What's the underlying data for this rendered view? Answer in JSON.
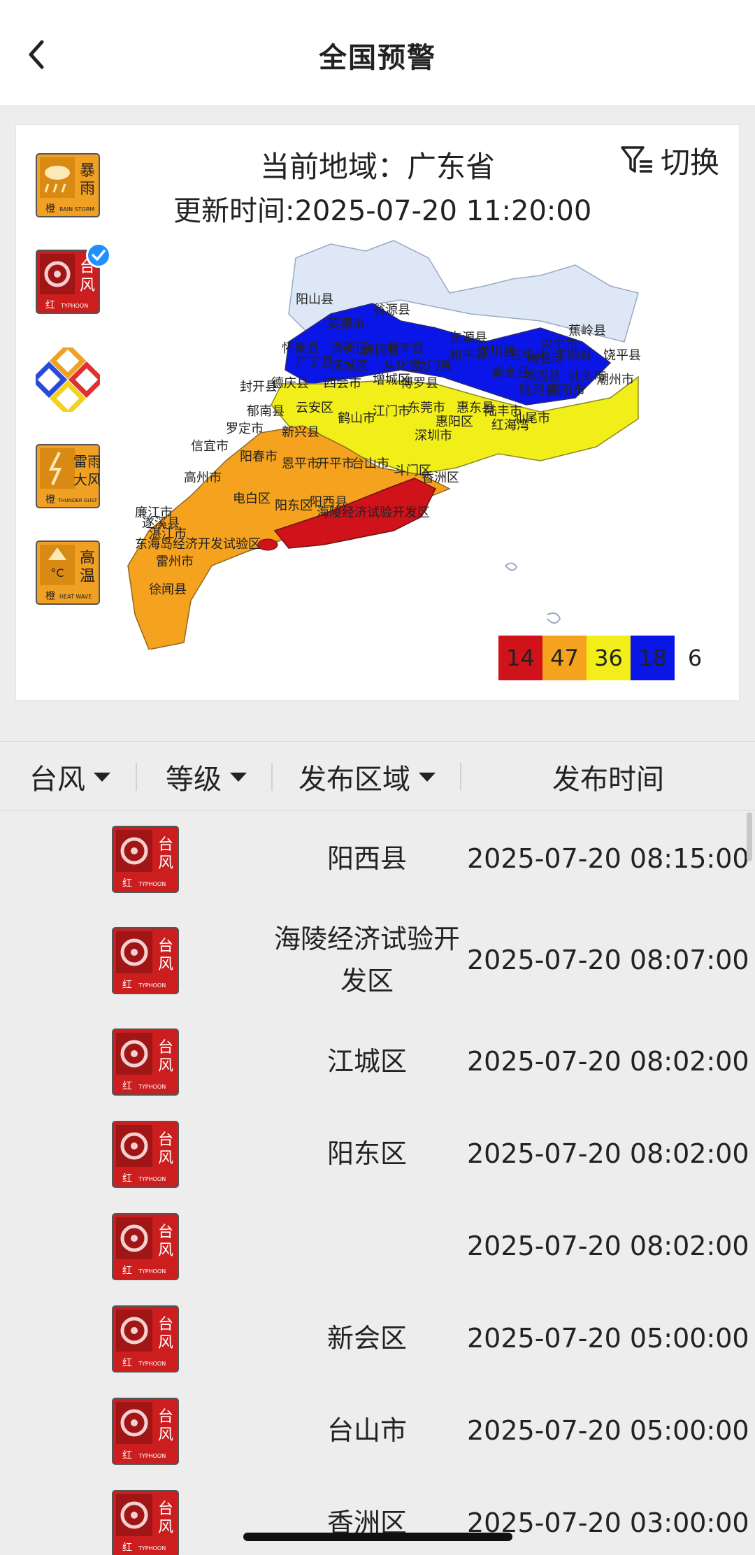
{
  "header": {
    "title": "全国预警",
    "back_icon": "chevron-left-icon"
  },
  "map_panel": {
    "region": "当前地域：广东省",
    "update_time": "更新时间:2025-07-20 11:20:00",
    "switch_label": "切换",
    "switch_icon": "filter-icon",
    "warning_types": [
      {
        "name": "暴雨",
        "level": "橙",
        "english": "RAIN STORM",
        "color": "#f0a023",
        "icon": "rainstorm-warning-icon"
      },
      {
        "name": "台风",
        "level": "红",
        "english": "TYPHOON",
        "color": "#cc1e1e",
        "icon": "typhoon-warning-icon",
        "selected": true
      },
      {
        "name": "",
        "level": "",
        "english": "",
        "color": "#f0a023",
        "icon": "multi-warning-icon"
      },
      {
        "name": "雷雨大风",
        "level": "橙",
        "english": "THUNDER GUST",
        "color": "#f0a023",
        "icon": "thunder-gust-warning-icon"
      },
      {
        "name": "高温",
        "level": "橙",
        "english": "HEAT WAVE",
        "color": "#f0a023",
        "icon": "heat-wave-warning-icon"
      }
    ],
    "map_labels": [
      "阳山县",
      "翁源县",
      "英德市",
      "新丰县",
      "东源县",
      "怀集县",
      "清新区",
      "佛冈县",
      "兴宁市",
      "蕉岭县",
      "五华县",
      "丰顺县",
      "饶平县",
      "广宁县",
      "清城区",
      "从化区",
      "龙门县",
      "和平县",
      "龙川县",
      "紫金县",
      "揭西县",
      "汕头市",
      "德庆县",
      "四会市",
      "增城区",
      "博罗县",
      "陆河县",
      "揭阳市",
      "封开县",
      "郁南县",
      "云安区",
      "东莞市",
      "惠东县",
      "陆丰市",
      "汕尾市",
      "罗定市",
      "新兴县",
      "鹤山市",
      "江门市",
      "惠阳区",
      "深圳市",
      "信宜市",
      "阳春市",
      "恩平市",
      "开平市",
      "台山市",
      "斗门区",
      "香洲区",
      "高州市",
      "电白区",
      "阳东区",
      "阳西县",
      "海陵经济试验开发区",
      "廉江市",
      "遂溪县",
      "湛江市",
      "东海岛经济开发试验区",
      "雷州市",
      "徐闻县",
      "红海湾",
      "梅县区",
      "潮州市"
    ],
    "legend": [
      {
        "count": "14",
        "color": "#d0121b"
      },
      {
        "count": "47",
        "color": "#f5a21f"
      },
      {
        "count": "36",
        "color": "#f2ee1a"
      },
      {
        "count": "18",
        "color": "#0a16e8"
      },
      {
        "count": "6",
        "color": "#ffffff"
      }
    ]
  },
  "filters": [
    {
      "label": "台风",
      "dropdown": true
    },
    {
      "label": "等级",
      "dropdown": true
    },
    {
      "label": "发布区域",
      "dropdown": true
    },
    {
      "label": "发布时间",
      "dropdown": false
    }
  ],
  "warnings": [
    {
      "type": "台风",
      "level": "红",
      "area": "阳西县",
      "time": "2025-07-20 08:15:00"
    },
    {
      "type": "台风",
      "level": "红",
      "area": "海陵经济试验开发区",
      "time": "2025-07-20 08:07:00"
    },
    {
      "type": "台风",
      "level": "红",
      "area": "江城区",
      "time": "2025-07-20 08:02:00"
    },
    {
      "type": "台风",
      "level": "红",
      "area": "阳东区",
      "time": "2025-07-20 08:02:00"
    },
    {
      "type": "台风",
      "level": "红",
      "area": "",
      "time": "2025-07-20 08:02:00"
    },
    {
      "type": "台风",
      "level": "红",
      "area": "新会区",
      "time": "2025-07-20 05:00:00"
    },
    {
      "type": "台风",
      "level": "红",
      "area": "台山市",
      "time": "2025-07-20 05:00:00"
    },
    {
      "type": "台风",
      "level": "红",
      "area": "香洲区",
      "time": "2025-07-20 03:00:00"
    }
  ]
}
